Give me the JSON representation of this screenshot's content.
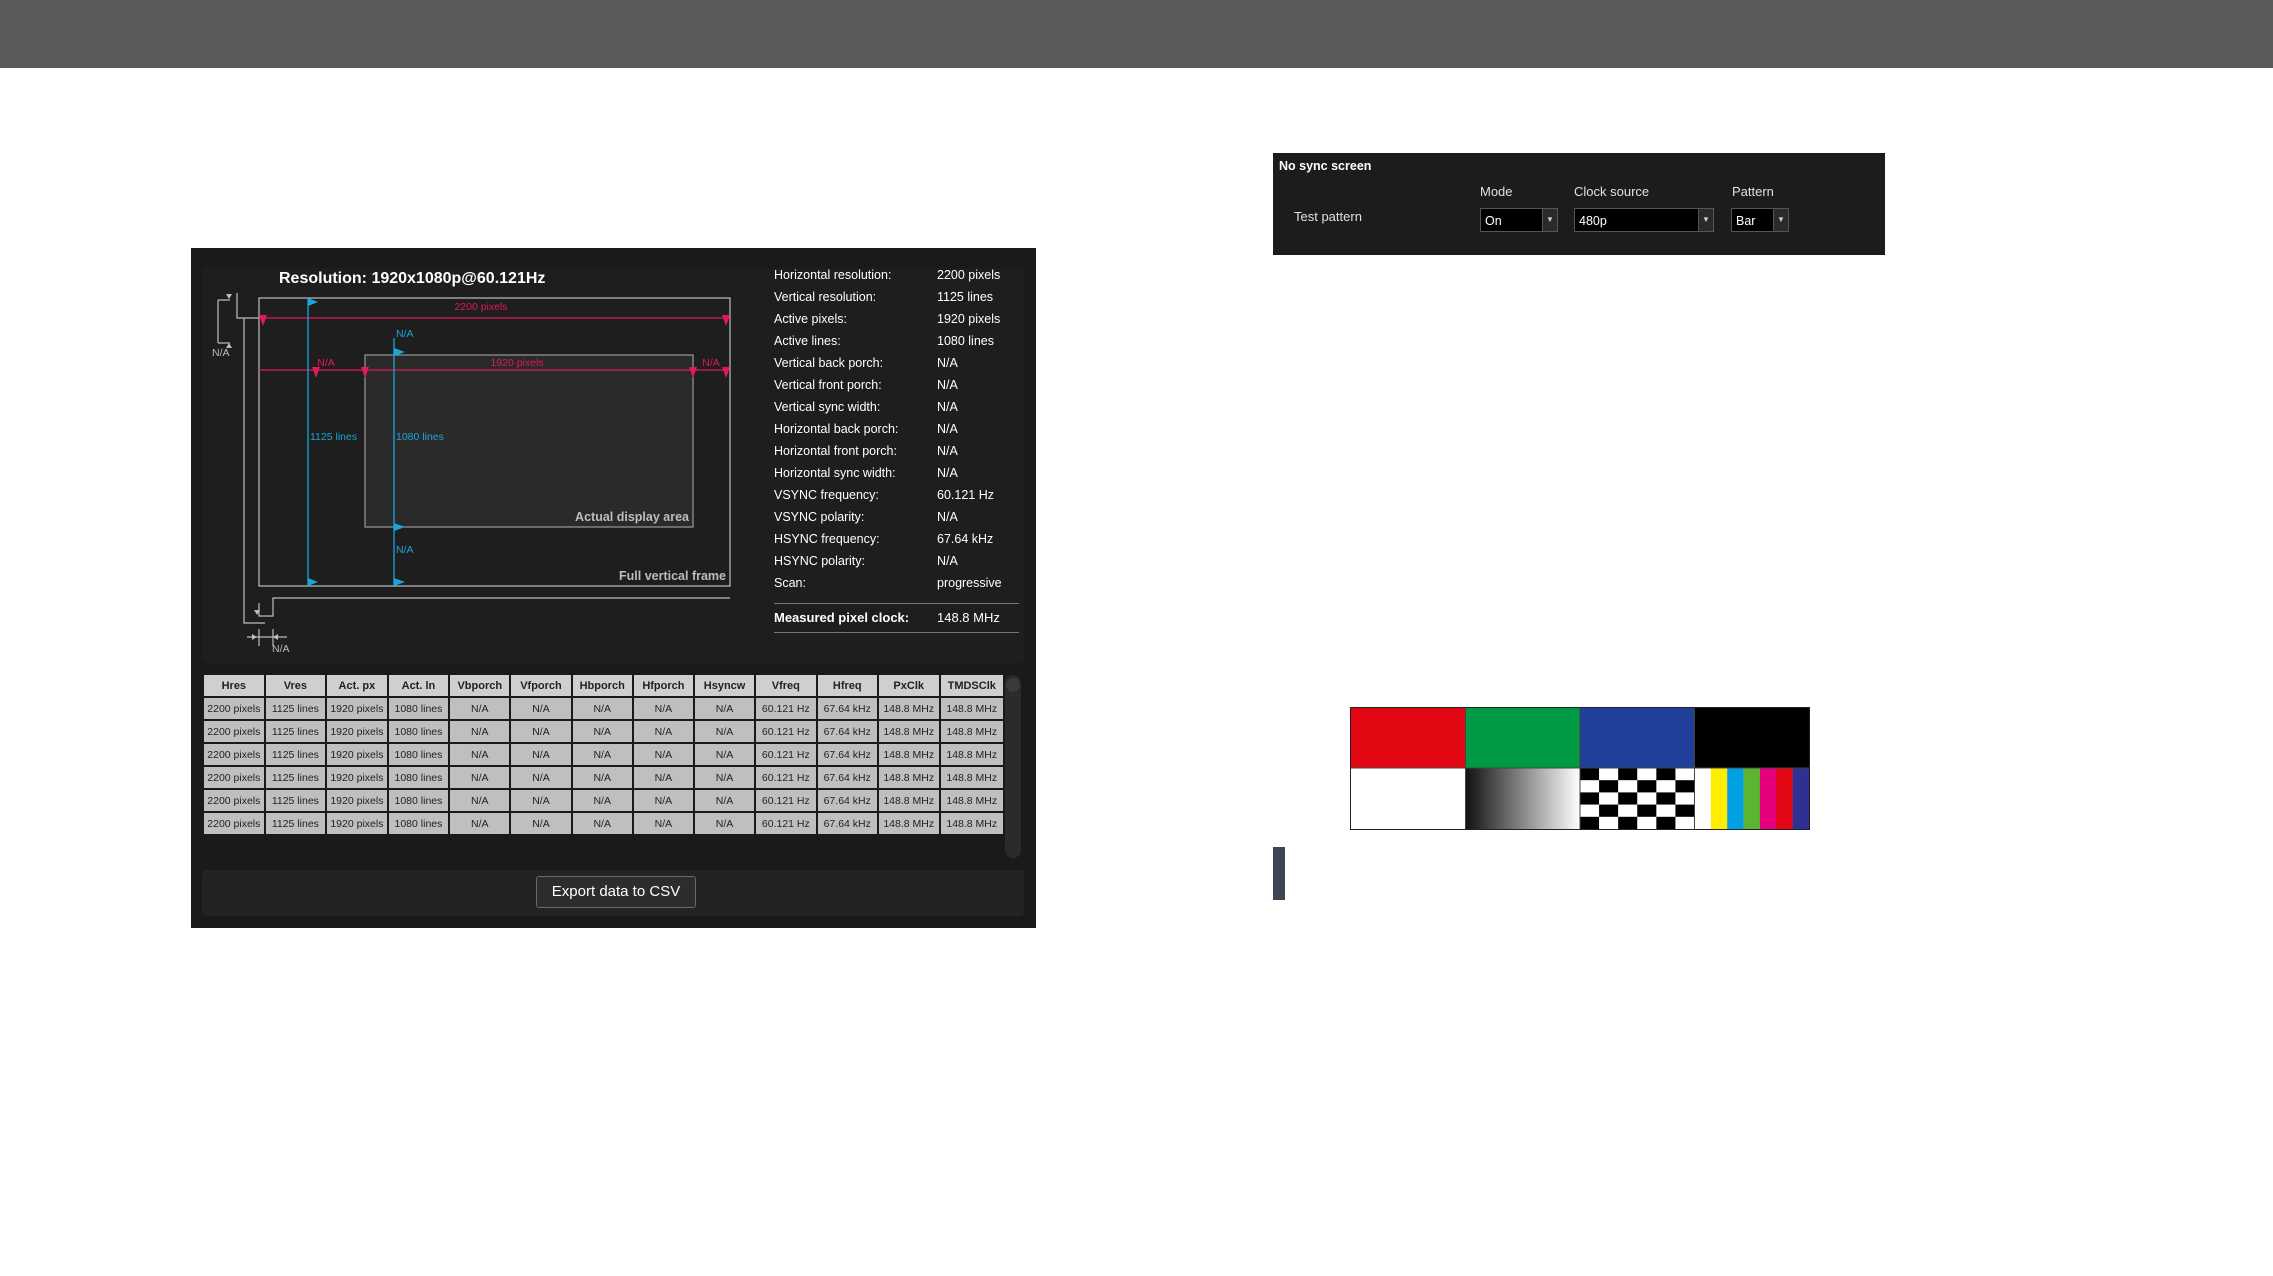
{
  "timing": {
    "resolution_title": "Resolution: 1920x1080p@60.121Hz",
    "diagram": {
      "total_h": "2200 pixels",
      "active_h": "1920 pixels",
      "total_v": "1125 lines",
      "active_v": "1080 lines",
      "h_back_porch": "N/A",
      "h_front_porch": "N/A",
      "v_back_porch": "N/A",
      "v_front_porch": "N/A",
      "v_sync": "N/A",
      "h_sync": "N/A",
      "active_area_label": "Actual display area",
      "frame_label": "Full vertical frame"
    },
    "info": [
      {
        "k": "Horizontal resolution:",
        "v": "2200 pixels"
      },
      {
        "k": "Vertical resolution:",
        "v": "1125 lines"
      },
      {
        "k": "Active pixels:",
        "v": "1920 pixels"
      },
      {
        "k": "Active lines:",
        "v": "1080 lines"
      },
      {
        "k": "Vertical back porch:",
        "v": "N/A"
      },
      {
        "k": "Vertical front porch:",
        "v": "N/A"
      },
      {
        "k": "Vertical sync width:",
        "v": "N/A"
      },
      {
        "k": "Horizontal back porch:",
        "v": "N/A"
      },
      {
        "k": "Horizontal front porch:",
        "v": "N/A"
      },
      {
        "k": "Horizontal sync width:",
        "v": "N/A"
      },
      {
        "k": "VSYNC frequency:",
        "v": "60.121 Hz"
      },
      {
        "k": "VSYNC polarity:",
        "v": "N/A"
      },
      {
        "k": "HSYNC frequency:",
        "v": "67.64 kHz"
      },
      {
        "k": "HSYNC polarity:",
        "v": "N/A"
      },
      {
        "k": "Scan:",
        "v": "progressive"
      }
    ],
    "pixel_clock": {
      "k": "Measured pixel clock:",
      "v": "148.8 MHz"
    },
    "table": {
      "headers": [
        "Hres",
        "Vres",
        "Act. px",
        "Act. ln",
        "Vbporch",
        "Vfporch",
        "Hbporch",
        "Hfporch",
        "Hsyncw",
        "Vfreq",
        "Hfreq",
        "PxClk",
        "TMDSClk"
      ],
      "rows": [
        [
          "2200 pixels",
          "1125 lines",
          "1920 pixels",
          "1080 lines",
          "N/A",
          "N/A",
          "N/A",
          "N/A",
          "N/A",
          "60.121 Hz",
          "67.64 kHz",
          "148.8 MHz",
          "148.8 MHz"
        ],
        [
          "2200 pixels",
          "1125 lines",
          "1920 pixels",
          "1080 lines",
          "N/A",
          "N/A",
          "N/A",
          "N/A",
          "N/A",
          "60.121 Hz",
          "67.64 kHz",
          "148.8 MHz",
          "148.8 MHz"
        ],
        [
          "2200 pixels",
          "1125 lines",
          "1920 pixels",
          "1080 lines",
          "N/A",
          "N/A",
          "N/A",
          "N/A",
          "N/A",
          "60.121 Hz",
          "67.64 kHz",
          "148.8 MHz",
          "148.8 MHz"
        ],
        [
          "2200 pixels",
          "1125 lines",
          "1920 pixels",
          "1080 lines",
          "N/A",
          "N/A",
          "N/A",
          "N/A",
          "N/A",
          "60.121 Hz",
          "67.64 kHz",
          "148.8 MHz",
          "148.8 MHz"
        ],
        [
          "2200 pixels",
          "1125 lines",
          "1920 pixels",
          "1080 lines",
          "N/A",
          "N/A",
          "N/A",
          "N/A",
          "N/A",
          "60.121 Hz",
          "67.64 kHz",
          "148.8 MHz",
          "148.8 MHz"
        ],
        [
          "2200 pixels",
          "1125 lines",
          "1920 pixels",
          "1080 lines",
          "N/A",
          "N/A",
          "N/A",
          "N/A",
          "N/A",
          "60.121 Hz",
          "67.64 kHz",
          "148.8 MHz",
          "148.8 MHz"
        ]
      ]
    },
    "export_label": "Export data to CSV"
  },
  "no_sync": {
    "title": "No sync screen",
    "row_label": "Test pattern",
    "mode": {
      "label": "Mode",
      "value": "On"
    },
    "clock_source": {
      "label": "Clock source",
      "value": "480p"
    },
    "pattern": {
      "label": "Pattern",
      "value": "Bar"
    }
  },
  "colors": {
    "magenta": "#e0185e",
    "cyan": "#1aa6d8",
    "red": "#e30613",
    "green": "#009a44",
    "blue": "#1f3f99"
  }
}
